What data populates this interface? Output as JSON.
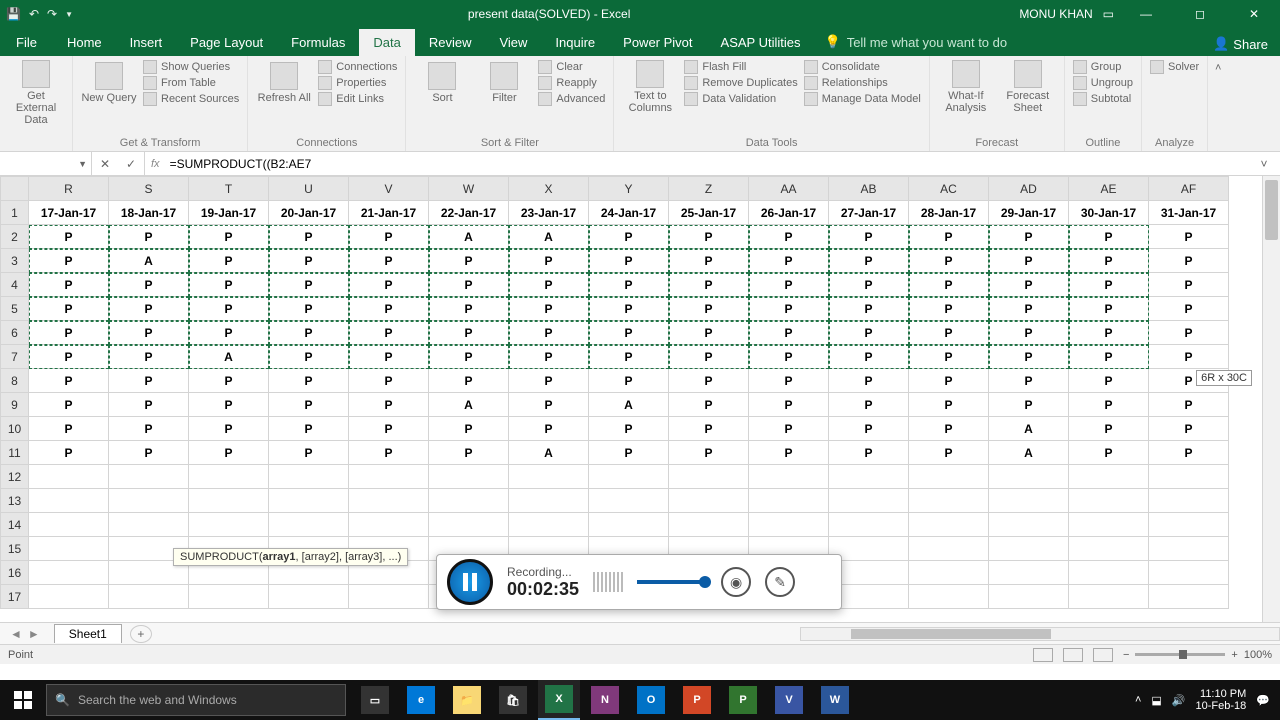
{
  "titlebar": {
    "title": "present data(SOLVED) - Excel",
    "user": "MONU KHAN"
  },
  "tabs": {
    "file": "File",
    "home": "Home",
    "insert": "Insert",
    "pagelayout": "Page Layout",
    "formulas": "Formulas",
    "data": "Data",
    "review": "Review",
    "view": "View",
    "inquire": "Inquire",
    "powerpivot": "Power Pivot",
    "asap": "ASAP Utilities",
    "tellme": "Tell me what you want to do",
    "share": "Share"
  },
  "ribbon": {
    "getexternal": "Get External Data",
    "newquery": "New Query",
    "showqueries": "Show Queries",
    "fromtable": "From Table",
    "recentsources": "Recent Sources",
    "gettransform": "Get & Transform",
    "refreshall": "Refresh All",
    "connections": "Connections",
    "properties": "Properties",
    "editlinks": "Edit Links",
    "connectionsgrp": "Connections",
    "sort": "Sort",
    "filter": "Filter",
    "clear": "Clear",
    "reapply": "Reapply",
    "advanced": "Advanced",
    "sortfilter": "Sort & Filter",
    "texttocols": "Text to Columns",
    "flashfill": "Flash Fill",
    "removedups": "Remove Duplicates",
    "datavalidation": "Data Validation",
    "consolidate": "Consolidate",
    "relationships": "Relationships",
    "managedm": "Manage Data Model",
    "datatools": "Data Tools",
    "whatif": "What-If Analysis",
    "forecastsheet": "Forecast Sheet",
    "forecast": "Forecast",
    "groupcmd": "Group",
    "ungroup": "Ungroup",
    "subtotal": "Subtotal",
    "outline": "Outline",
    "solver": "Solver",
    "analyze": "Analyze"
  },
  "namebox": "",
  "formula": "=SUMPRODUCT((B2:AE7",
  "fntip_fn": "SUMPRODUCT(",
  "fntip_a1": "array1",
  "fntip_rest": ", [array2], [array3], ...)",
  "seltip": "6R x 30C",
  "columns": [
    "R",
    "S",
    "T",
    "U",
    "V",
    "W",
    "X",
    "Y",
    "Z",
    "AA",
    "AB",
    "AC",
    "AD",
    "AE",
    "AF"
  ],
  "headers": [
    "17-Jan-17",
    "18-Jan-17",
    "19-Jan-17",
    "20-Jan-17",
    "21-Jan-17",
    "22-Jan-17",
    "23-Jan-17",
    "24-Jan-17",
    "25-Jan-17",
    "26-Jan-17",
    "27-Jan-17",
    "28-Jan-17",
    "29-Jan-17",
    "30-Jan-17",
    "31-Jan-17"
  ],
  "rows": [
    [
      "P",
      "P",
      "P",
      "P",
      "P",
      "A",
      "A",
      "P",
      "P",
      "P",
      "P",
      "P",
      "P",
      "P",
      "P"
    ],
    [
      "P",
      "A",
      "P",
      "P",
      "P",
      "P",
      "P",
      "P",
      "P",
      "P",
      "P",
      "P",
      "P",
      "P",
      "P"
    ],
    [
      "P",
      "P",
      "P",
      "P",
      "P",
      "P",
      "P",
      "P",
      "P",
      "P",
      "P",
      "P",
      "P",
      "P",
      "P"
    ],
    [
      "P",
      "P",
      "P",
      "P",
      "P",
      "P",
      "P",
      "P",
      "P",
      "P",
      "P",
      "P",
      "P",
      "P",
      "P"
    ],
    [
      "P",
      "P",
      "P",
      "P",
      "P",
      "P",
      "P",
      "P",
      "P",
      "P",
      "P",
      "P",
      "P",
      "P",
      "P"
    ],
    [
      "P",
      "P",
      "A",
      "P",
      "P",
      "P",
      "P",
      "P",
      "P",
      "P",
      "P",
      "P",
      "P",
      "P",
      "P"
    ],
    [
      "P",
      "P",
      "P",
      "P",
      "P",
      "P",
      "P",
      "P",
      "P",
      "P",
      "P",
      "P",
      "P",
      "P",
      "P"
    ],
    [
      "P",
      "P",
      "P",
      "P",
      "P",
      "A",
      "P",
      "A",
      "P",
      "P",
      "P",
      "P",
      "P",
      "P",
      "P"
    ],
    [
      "P",
      "P",
      "P",
      "P",
      "P",
      "P",
      "P",
      "P",
      "P",
      "P",
      "P",
      "P",
      "A",
      "P",
      "P"
    ],
    [
      "P",
      "P",
      "P",
      "P",
      "P",
      "P",
      "A",
      "P",
      "P",
      "P",
      "P",
      "P",
      "A",
      "P",
      "P"
    ]
  ],
  "sheet": {
    "name": "Sheet1"
  },
  "status": {
    "mode": "Point",
    "zoom": "100%"
  },
  "recorder": {
    "label": "Recording...",
    "time": "00:02:35"
  },
  "taskbar": {
    "search": "Search the web and Windows",
    "time": "11:10 PM",
    "date": "10-Feb-18"
  }
}
